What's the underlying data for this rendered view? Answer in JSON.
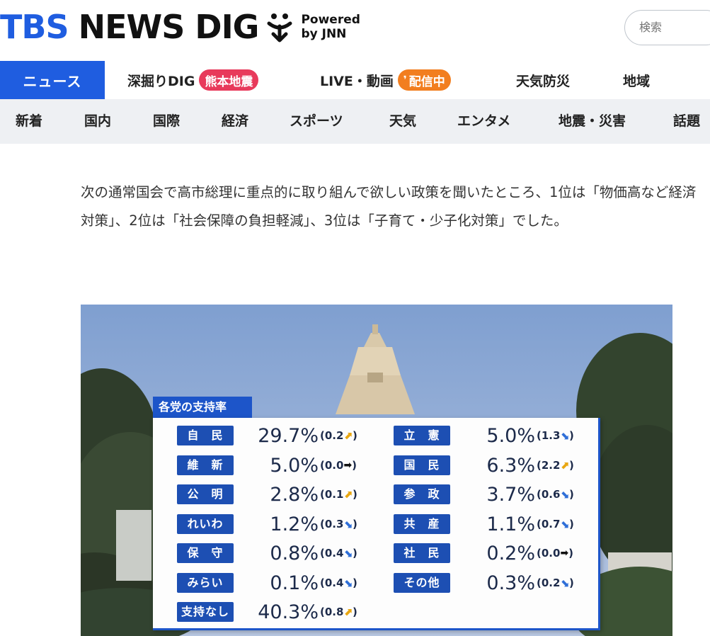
{
  "header": {
    "logo_tbs": "TBS",
    "logo_news": "NEWS DIG",
    "logo_powered_1": "Powered",
    "logo_powered_2": "by JNN",
    "search_placeholder": "検索"
  },
  "nav_primary": [
    {
      "label": "ニュース",
      "active": true
    },
    {
      "label": "深掘りDIG",
      "badge": "熊本地震",
      "badge_color": "#e83a5b"
    },
    {
      "label": "LIVE・動画",
      "badge": "配信中",
      "badge_color": "#f27e1f"
    },
    {
      "label": "天気防災"
    },
    {
      "label": "地域"
    }
  ],
  "nav_secondary": [
    "新着",
    "国内",
    "国際",
    "経済",
    "スポーツ",
    "天気",
    "エンタメ",
    "地震・災害",
    "話題"
  ],
  "article": {
    "paragraph": "次の通常国会で高市総理に重点的に取り組んで欲しい政策を聞いたところ、1位は「物価高など経済対策」、2位は「社会保障の負担軽減」、3位は「子育て・少子化対策」でした。"
  },
  "figure": {
    "panel_title": "各党の支持率",
    "left": [
      {
        "party": "自　民",
        "pct": "29.7%",
        "change": "0.2",
        "dir": "up"
      },
      {
        "party": "維　新",
        "pct": "5.0%",
        "change": "0.0",
        "dir": "flat"
      },
      {
        "party": "公　明",
        "pct": "2.8%",
        "change": "0.1",
        "dir": "up"
      },
      {
        "party": "れいわ",
        "pct": "1.2%",
        "change": "0.3",
        "dir": "down"
      },
      {
        "party": "保　守",
        "pct": "0.8%",
        "change": "0.4",
        "dir": "down"
      },
      {
        "party": "みらい",
        "pct": "0.1%",
        "change": "0.4",
        "dir": "down"
      },
      {
        "party": "支持なし",
        "pct": "40.3%",
        "change": "0.8",
        "dir": "up"
      }
    ],
    "right": [
      {
        "party": "立　憲",
        "pct": "5.0%",
        "change": "1.3",
        "dir": "down"
      },
      {
        "party": "国　民",
        "pct": "6.3%",
        "change": "2.2",
        "dir": "up"
      },
      {
        "party": "参　政",
        "pct": "3.7%",
        "change": "0.6",
        "dir": "down"
      },
      {
        "party": "共　産",
        "pct": "1.1%",
        "change": "0.7",
        "dir": "down"
      },
      {
        "party": "社　民",
        "pct": "0.2%",
        "change": "0.0",
        "dir": "flat"
      },
      {
        "party": "その他",
        "pct": "0.3%",
        "change": "0.2",
        "dir": "down"
      }
    ],
    "colors": {
      "label_bg": "#1d4fb3",
      "up": "#e8a712",
      "down": "#2f6fd8",
      "flat": "#111111"
    }
  }
}
